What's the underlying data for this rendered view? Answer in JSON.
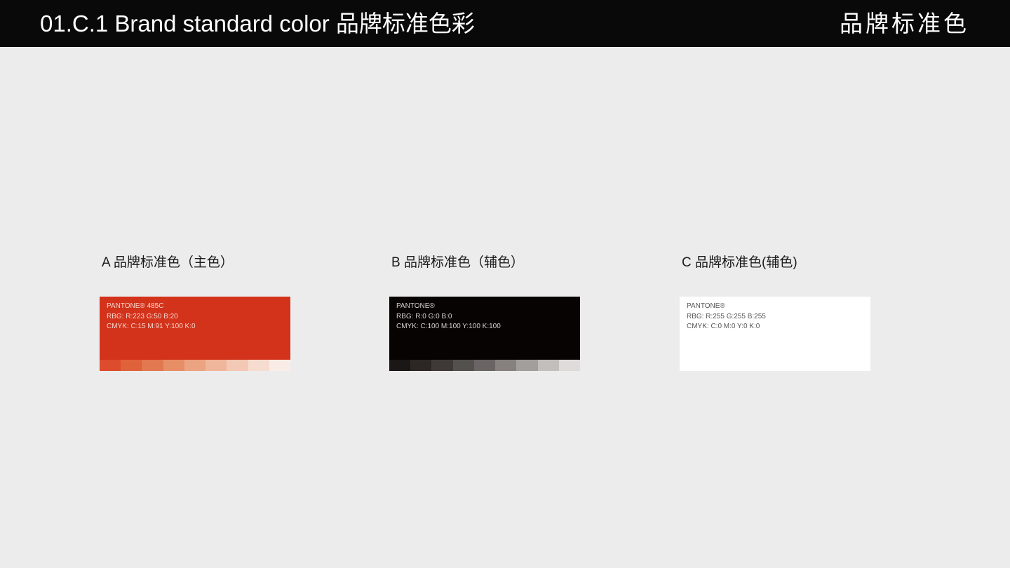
{
  "header": {
    "title": "01.C.1 Brand standard color 品牌标准色彩",
    "right_label": "品牌标准色"
  },
  "sections": [
    {
      "label": "A 品牌标准色（主色）",
      "card": {
        "background": "#d3321b",
        "text_color": "#f7d6cc",
        "pantone": "PANTONE®   485C",
        "rgb": "RBG: R:223 G:50 B:20",
        "cmyk": "CMYK: C:15 M:91 Y:100 K:0"
      },
      "swatches": [
        "#dd4c2d",
        "#e0623b",
        "#e2784f",
        "#e78e66",
        "#eca382",
        "#f0b69b",
        "#f3c8b4",
        "#f6dccf",
        "#f9ece6"
      ]
    },
    {
      "label": "B 品牌标准色（辅色）",
      "card": {
        "background": "#070303",
        "text_color": "#d8d2d0",
        "pantone": "PANTONE®",
        "rgb": "RBG: R:0 G:0 B:0",
        "cmyk": "CMYK: C:100 M:100 Y:100 K:100"
      },
      "swatches": [
        "#1a1716",
        "#2c2725",
        "#3f3a38",
        "#54504e",
        "#6a6564",
        "#86807e",
        "#a29e9c",
        "#c1bebc",
        "#dedbda"
      ]
    },
    {
      "label": "C 品牌标准色(辅色)",
      "card": {
        "background": "#ffffff",
        "text_color": "#555555",
        "pantone": "PANTONE®",
        "rgb": "RBG: R:255 G:255 B:255",
        "cmyk": "CMYK: C:0 M:0 Y:0 K:0"
      },
      "swatches": []
    }
  ]
}
